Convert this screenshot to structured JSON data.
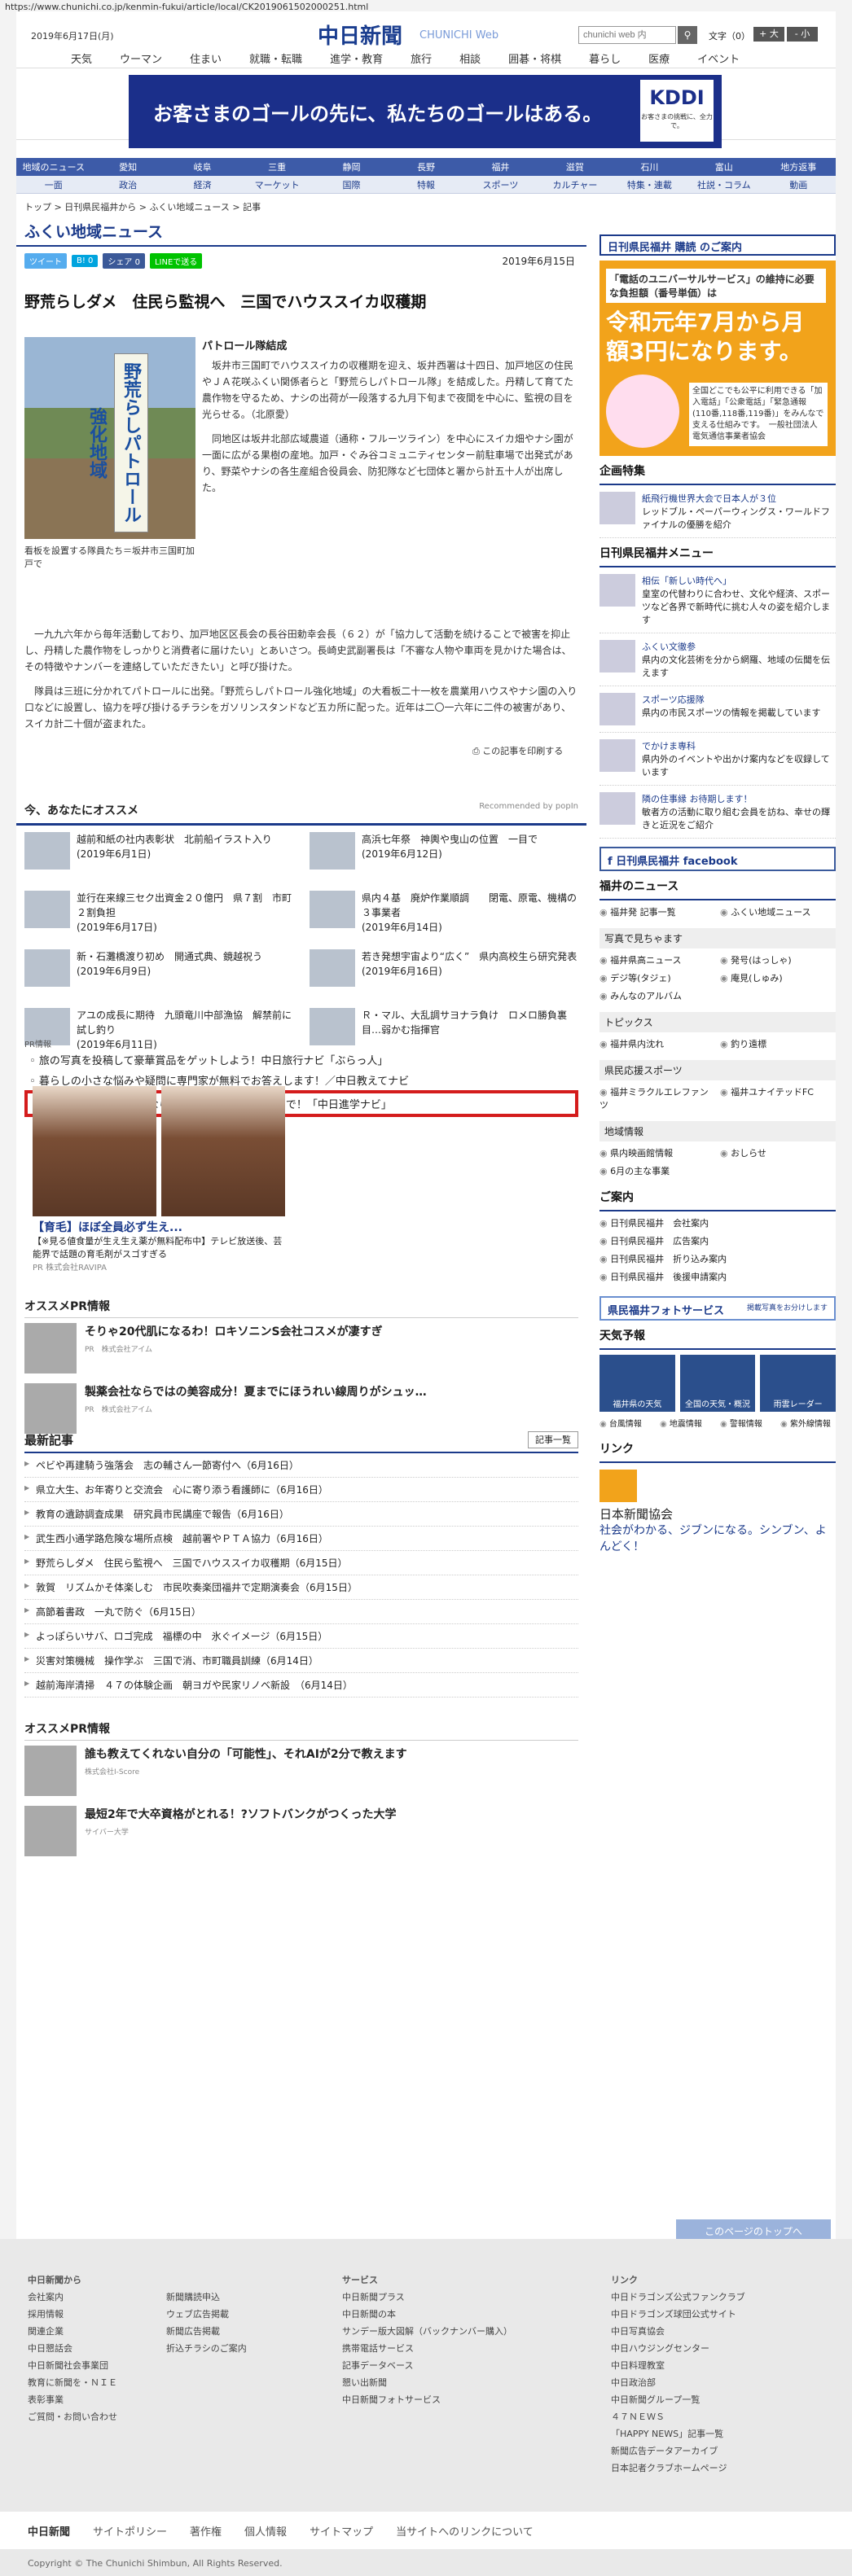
{
  "url": "https://www.chunichi.co.jp/kenmin-fukui/article/local/CK2019061502000251.html",
  "header": {
    "date": "2019年6月17日(月)",
    "logo": "中日新聞",
    "logo_sub": "CHUNICHI Web",
    "search_placeholder": "chunichi web 内",
    "search_icon": "magnifier-icon",
    "font_label": "文字（0）",
    "font_big": "+ 大",
    "font_small": "- 小",
    "nav": [
      "天気",
      "ウーマン",
      "住まい",
      "就職・転職",
      "進学・教育",
      "旅行",
      "相談",
      "囲碁・将棋",
      "暮らし",
      "医療",
      "イベント"
    ]
  },
  "ad": {
    "text": "お客さまのゴールの先に、私たちのゴールはある。",
    "brand": "KDDI",
    "brand_sub": "お客さまの挑戦に、全力で。"
  },
  "nav1": [
    "地域のニュース",
    "愛知",
    "岐阜",
    "三重",
    "静岡",
    "長野",
    "福井",
    "滋賀",
    "石川",
    "富山",
    "地方返事"
  ],
  "nav2": [
    "一面",
    "政治",
    "経済",
    "マーケット",
    "国際",
    "特報",
    "スポーツ",
    "カルチャー",
    "特集・連載",
    "社説・コラム",
    "動画"
  ],
  "breadcrumb": "トップ > 日刊県民福井から > ふくい地域ニュース > 記事",
  "section": "ふくい地域ニュース",
  "share": [
    "ツイート",
    "B! 0",
    "シェア 0",
    "LINEで送る"
  ],
  "pub_date": "2019年6月15日",
  "article": {
    "title": "野荒らしダメ　住民ら監視へ　三国でハウススイカ収穫期",
    "sign_text": "野荒らしパトロール強化地域",
    "caption": "看板を設置する隊員たち＝坂井市三国町加戸で",
    "subtitle": "パトロール隊結成",
    "p1": "　坂井市三国町でハウススイカの収穫期を迎え、坂井西署は十四日、加戸地区の住民やＪＡ花咲ふくい関係者らと「野荒らしパトロール隊」を結成した。丹精して育てた農作物を守るため、ナシの出荷が一段落する九月下旬まで夜間を中心に、監視の目を光らせる。（北原愛）",
    "p2": "　同地区は坂井北部広域農道（通称・フルーツライン）を中心にスイカ畑やナシ園が一面に広がる果樹の産地。加戸・ぐみ谷コミュニティセンター前駐車場で出発式があり、野菜やナシの各生産組合役員会、防犯隊など七団体と署から計五十人が出席した。",
    "p3": "　一九九六年から毎年活動しており、加戸地区区長会の長谷田勅幸会長（６２）が「協力して活動を続けることで被害を抑止し、丹精した農作物をしっかりと消費者に届けたい」とあいさつ。長崎史武副署長は「不審な人物や車両を見かけた場合は、その特徴やナンバーを連絡していただきたい」と呼び掛けた。",
    "p4": "　隊員は三班に分かれてパトロールに出発。「野荒らしパトロール強化地域」の大看板二十一枚を農業用ハウスやナシ園の入り口などに設置し、協力を呼び掛けるチラシをガソリンスタンドなど五カ所に配った。近年は二〇一六年に二件の被害があり、スイカ計二十個が盗まれた。",
    "print": "この記事を印刷する"
  },
  "recommend": {
    "title": "今、あなたにオススメ",
    "powered": "Recommended by popIn",
    "items": [
      {
        "t": "越前和紙の社内表彰状　北前船イラスト入り",
        "d": "(2019年6月1日)"
      },
      {
        "t": "高浜七年祭　神輿や曳山の位置　一目で",
        "d": "(2019年6月12日)"
      },
      {
        "t": "並行在来線三セク出資金２０億円　県７割　市町２割負担",
        "d": "(2019年6月17日)"
      },
      {
        "t": "県内４基　廃炉作業順調　　閉電、原電、機構の３事業者",
        "d": "(2019年6月14日)"
      },
      {
        "t": "新・石灘橋渡り初め　開通式典、鏡越祝う",
        "d": "(2019年6月9日)"
      },
      {
        "t": "若き発想宇宙より“広く”　県内高校生ら研究発表",
        "d": "(2019年6月16日)"
      },
      {
        "t": "アユの成長に期待　九頭竜川中部漁協　解禁前に試し釣り",
        "d": "(2019年6月11日)"
      },
      {
        "t": "Ｒ・マル、大乱調サヨナラ負け　ロメロ勝負裏目…弱かむ指揮官",
        "d": ""
      }
    ]
  },
  "pr": {
    "label": "PR情報",
    "links": [
      "旅の写真を投稿して豪華賞品をゲットしよう！中日旅行ナビ「ぶらっ人」",
      "暮らしの小さな悩みや疑問に専門家が無料でお答えします！／中日教えてナビ",
      "中部地区の大学を探すなら、地元の進学情報サイトで！「中日進学ナビ」"
    ]
  },
  "hair_ad": {
    "title": "【育毛】ほぼ全員必ず生え...",
    "text": "【※見る値食量が生え生え薬が無料配布中】テレビ放送後、芸能界で話題の育毛剤がスゴすぎる",
    "sponsor": "PR 株式会社RAVIPA"
  },
  "ospr": {
    "title": "オススメPR情報",
    "items": [
      {
        "t": "そりゃ20代肌になるわ！ロキソニンS会社コスメが凄すぎ",
        "s": "PR　株式会社アイム"
      },
      {
        "t": "製薬会社ならではの美容成分！夏までにほうれい線周りがシュッ…",
        "s": "PR　株式会社アイム"
      }
    ]
  },
  "latest": {
    "title": "最新記事",
    "more": "記事一覧",
    "items": [
      "ペビや再建騎う強落会　志の輔さん一節寄付へ（6月16日）",
      "県立大生、お年寄りと交流会　心に寄り添う看護師に（6月16日）",
      "教育の遺跡調査成果　研究員市民講座で報告（6月16日）",
      "武生西小通学路危険な場所点検　越前署やＰＴＡ協力（6月16日）",
      "野荒らしダメ　住民ら監視へ　三国でハウススイカ収穫期（6月15日）",
      "敦賀　リズムかそ体楽しむ　市民吹奏楽団福井で定期演奏会（6月15日）",
      "高節着書政　一丸で防ぐ（6月15日）",
      "よっぽらいサバ、ロゴ完成　福標の中　氷ぐイメージ（6月15日）",
      "災害対策機械　操作学ぶ　三国で消、市町職員訓練（6月14日）",
      "越前海岸清掃　４７の体験企画　朝ヨガや民家リノベ新設　（6月14日）"
    ]
  },
  "ospr2": {
    "title": "オススメPR情報",
    "items": [
      {
        "t": "誰も教えてくれない自分の「可能性」、それAIが2分で教えます",
        "s": "株式会社I-Score"
      },
      {
        "t": "最短2年で大卒資格がとれる！?ソフトバンクがつくった大学",
        "s": "サイバー大学"
      }
    ]
  },
  "side": {
    "kanyu": "日刊県民福井 購読 のご案内",
    "uni_a": "「電話のユニバーサルサービス」の維持に必要な負担額（番号単価）は",
    "uni_b": "令和元年7月から月額3円になります。",
    "uni_d": "全国どこでも公平に利用できる「加入電話」「公衆電話」「緊急通報(110番,118番,119番)」をみんなで支える仕組みです。　一般社団法人 電気通信事業者協会",
    "kikaku_title": "企画特集",
    "kikaku_item": {
      "t": "紙飛行機世界大会で日本人が３位",
      "d": "レッドブル・ペーパーウィングス・ワールドファイナルの優勝を紹介"
    },
    "menu_title": "日刊県民福井メニュー",
    "menu": [
      {
        "t": "相伝「新しい時代へ」",
        "d": "皇室の代替わりに合わせ、文化や経済、スポーツなど各界で新時代に挑む人々の姿を紹介します"
      },
      {
        "t": "ふくい文徹参",
        "d": "県内の文化芸術を分から網羅、地域の伝聞を伝えます"
      },
      {
        "t": "スポーツ応援隊",
        "d": "県内の市民スポーツの情報を掲載しています"
      },
      {
        "t": "でかけま専科",
        "d": "県内外のイベントや出かけ案内などを収録しています"
      },
      {
        "t": "隣の住事縁 お待期します！",
        "d": "敏者方の活動に取り組む会員を訪ね、幸せの輝きと近況をご紹介"
      }
    ],
    "facebook": "日刊県民福井 facebook",
    "fnews_title": "福井のニュース",
    "fnews": [
      "福井発 記事一覧",
      "ふくい地域ニュース"
    ],
    "photo_hd": "写真で見ちゃます",
    "photo": [
      "福井県高ニュース",
      "発号(はっしゃ)",
      "デジ等(タジェ)",
      "庵見(しゅみ)",
      "みんなのアルバム"
    ],
    "topics_hd": "トピックス",
    "topics": [
      "福井県内沈れ",
      "釣り遠標"
    ],
    "sports_hd": "県民応援スポーツ",
    "sports": [
      "福井ミラクルエレファンツ",
      "福井ユナイテッドFC"
    ],
    "info_hd": "地域情報",
    "info": [
      "県内映画館情報",
      "おしらせ",
      "6月の主な事業"
    ],
    "annai_title": "ご案内",
    "annai": [
      "日刊県民福井　会社案内",
      "日刊県民福井　広告案内",
      "日刊県民福井　折り込み案内",
      "日刊県民福井　後援申請案内"
    ],
    "photo_service": "県民福井フォトサービス",
    "photo_service_sub": "掲載写真をお分けします",
    "tenki_title": "天気予報",
    "tenki": [
      "福井県の天気",
      "全国の天気・概況",
      "雨雲レーダー"
    ],
    "tenki_links": [
      "台風情報",
      "地震情報",
      "警報情報",
      "紫外線情報"
    ],
    "link_title": "リンク",
    "link_name": "日本新聞協会",
    "link_text": "社会がわかる、ジブンになる。シンブン、よんどく！"
  },
  "footer": {
    "totop": "このページのトップへ",
    "c1_title": "中日新聞から",
    "c1": [
      "会社案内",
      "採用情報",
      "関連企業",
      "中日懇話会",
      "中日新聞社会事業団",
      "教育に新聞を・ＮＩＥ",
      "表彰事業",
      "ご質問・お問い合わせ"
    ],
    "c2": [
      "新聞購読申込",
      "ウェブ広告掲載",
      "新聞広告掲載",
      "折込チラシのご案内"
    ],
    "c3_title": "サービス",
    "c3": [
      "中日新聞プラス",
      "中日新聞の本",
      "サンデー版大図解（バックナンバー購入）",
      "携帯電話サービス",
      "記事データベース",
      "懇い出新聞",
      "中日新聞フォトサービス"
    ],
    "c4_title": "リンク",
    "c4": [
      "中日ドラゴンズ公式ファンクラブ",
      "中日ドラゴンズ球団公式サイト",
      "中日写真協会",
      "中日ハウジングセンター",
      "中日料理教室",
      "中日政治部",
      "中日新聞グループ一覧",
      "４７ＮＥＷＳ",
      "「HAPPY NEWS」記事一覧",
      "新聞広告データアーカイブ",
      "日本記者クラブホームページ"
    ],
    "bar": [
      "中日新聞",
      "サイトポリシー",
      "著作権",
      "個人情報",
      "サイトマップ",
      "当サイトへのリンクについて"
    ],
    "copy": "Copyright © The Chunichi Shimbun, All Rights Reserved."
  }
}
